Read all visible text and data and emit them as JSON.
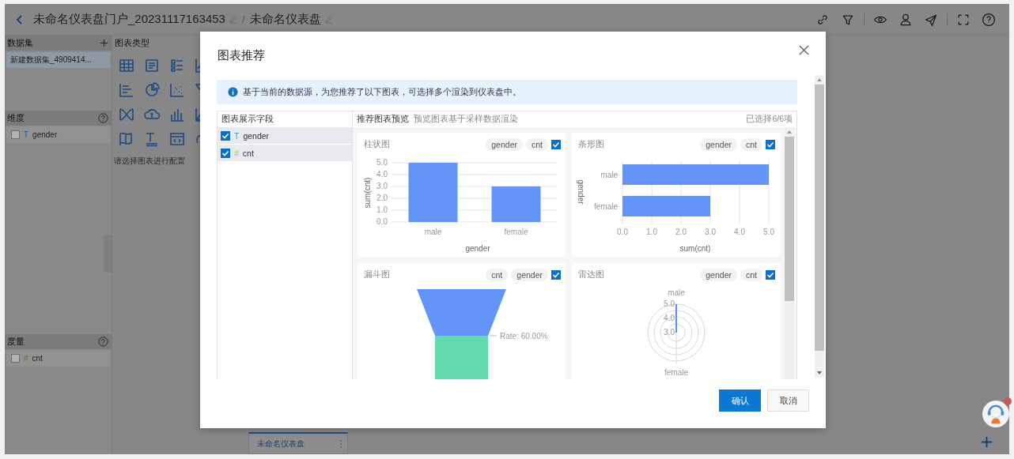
{
  "breadcrumb": [
    {
      "text": "未命名仪表盘门户_20231117163453",
      "editable": true
    },
    {
      "text": "未命名仪表盘",
      "editable": true
    }
  ],
  "separator": "/",
  "sidebar": {
    "datasets_title": "数据集",
    "datasets": [
      {
        "label": "新建数据集_4909414...",
        "selected": true
      }
    ],
    "dimensions": {
      "title": "维度",
      "fields": [
        {
          "glyph": "T",
          "label": "gender",
          "kind": "dimension",
          "checked": false
        }
      ]
    },
    "measures": {
      "title": "度量",
      "fields": [
        {
          "glyph": "#",
          "label": "cnt",
          "kind": "measure",
          "checked": false
        }
      ]
    }
  },
  "chart_types": {
    "title": "图表类型",
    "hint": "请选择图表进行配置"
  },
  "tabs": [
    {
      "label": "未命名仪表盘",
      "selected": true
    }
  ],
  "dialog": {
    "title": "图表推荐",
    "info": "基于当前的数据源，为您推荐了以下图表，可选择多个渲染到仪表盘中。",
    "fields_title": "图表展示字段",
    "fields": [
      {
        "glyph": "T",
        "label": "gender",
        "kind": "dimension",
        "checked": true
      },
      {
        "glyph": "#",
        "label": "cnt",
        "kind": "measure",
        "checked": true
      }
    ],
    "preview_title": "推荐图表预览",
    "preview_hint": "预览图表基于采样数据渲染",
    "selection_count": "已选择6/6项",
    "charts": [
      {
        "title": "柱状图",
        "tags": [
          "gender",
          "cnt"
        ],
        "checked": true,
        "kind": "bar",
        "chart_data": {
          "type": "bar",
          "grid": true,
          "xlabel": "gender",
          "ylabel": "sum(cnt)",
          "categories": [
            "male",
            "female"
          ],
          "values": [
            5,
            3
          ],
          "ylim": [
            0,
            5
          ],
          "yticks": [
            {
              "value": 0,
              "label": "0.0"
            },
            {
              "value": 1,
              "label": "1.0"
            },
            {
              "value": 2,
              "label": "2.0"
            },
            {
              "value": 3,
              "label": "3.0"
            },
            {
              "value": 4,
              "label": "4.0"
            },
            {
              "value": 5,
              "label": "5.0"
            }
          ]
        }
      },
      {
        "title": "条形图",
        "tags": [
          "gender",
          "cnt"
        ],
        "checked": true,
        "kind": "hbar",
        "chart_data": {
          "type": "bar",
          "grid": true,
          "orientation": "horizontal",
          "xlabel": "sum(cnt)",
          "ylabel": "gender",
          "categories": [
            "male",
            "female"
          ],
          "values": [
            5,
            3
          ],
          "xlim": [
            0,
            5
          ],
          "xticks": [
            {
              "value": 0,
              "label": "0.0"
            },
            {
              "value": 1,
              "label": "1.0"
            },
            {
              "value": 2,
              "label": "2.0"
            },
            {
              "value": 3,
              "label": "3.0"
            },
            {
              "value": 4,
              "label": "4.0"
            },
            {
              "value": 5,
              "label": "5.0"
            }
          ]
        }
      },
      {
        "title": "漏斗图",
        "tags": [
          "cnt",
          "gender"
        ],
        "checked": true,
        "kind": "funnel",
        "rate_label": "Rate: 60.00%"
      },
      {
        "title": "雷达图",
        "tags": [
          "gender",
          "cnt"
        ],
        "checked": true,
        "kind": "radar",
        "axis_labels": [
          "male",
          "female"
        ],
        "ring_labels": [
          "5.0",
          "4.0",
          "3.0"
        ]
      }
    ],
    "buttons": [
      {
        "label": "确认",
        "kind": "primary"
      },
      {
        "label": "取消",
        "kind": "default"
      }
    ]
  }
}
